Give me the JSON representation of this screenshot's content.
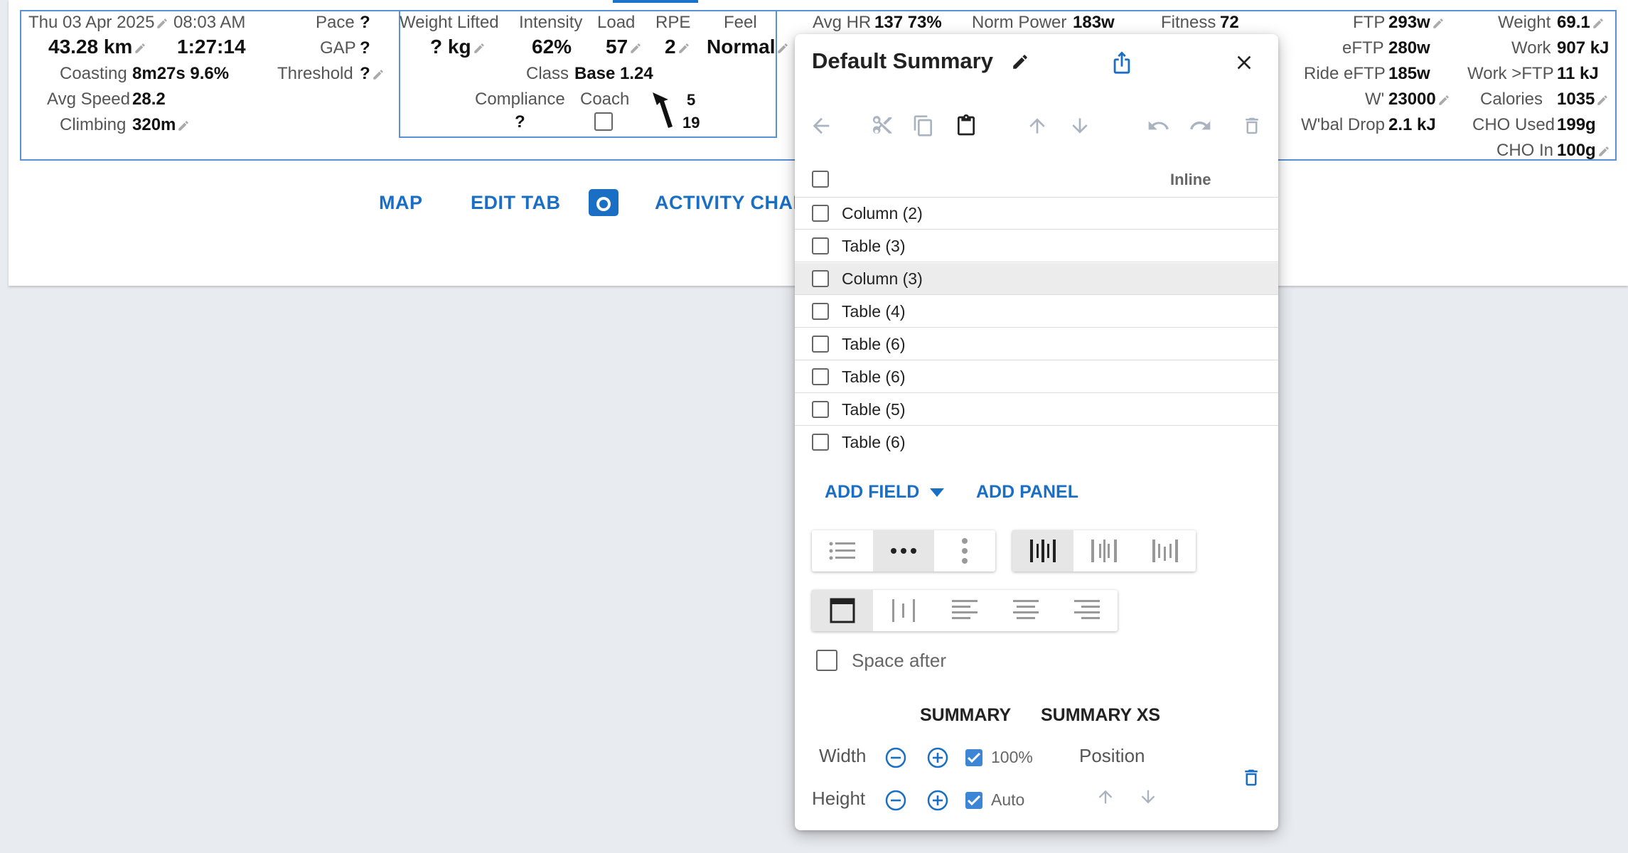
{
  "summary": {
    "date": "Thu 03 Apr 2025",
    "time": "08:03 AM",
    "distance": "43.28 km",
    "duration": "1:27:14",
    "coasting_label": "Coasting",
    "coasting_value": "8m27s 9.6%",
    "avg_speed_label": "Avg Speed",
    "avg_speed_value": "28.2",
    "climbing_label": "Climbing",
    "climbing_value": "320m",
    "pace_label": "Pace",
    "pace_value": "?",
    "gap_label": "GAP",
    "gap_value": "?",
    "threshold_label": "Threshold",
    "threshold_value": "?",
    "weight_lifted_label": "Weight Lifted",
    "weight_lifted_value": "? kg",
    "intensity_label": "Intensity",
    "intensity_value": "62%",
    "load_label": "Load",
    "load_value": "57",
    "rpe_label": "RPE",
    "rpe_value": "2",
    "feel_label": "Feel",
    "feel_value": "Normal",
    "class_label": "Class",
    "class_value": "Base 1.24",
    "compliance_label": "Compliance",
    "compliance_value": "?",
    "coach_label": "Coach",
    "arrow_num_1": "5",
    "arrow_num_2": "19",
    "avg_hr_label": "Avg HR",
    "avg_hr_value": "137 73%",
    "norm_power_label": "Norm Power",
    "norm_power_value": "183w",
    "fitness_label": "Fitness",
    "fitness_value": "72",
    "ftp_label": "FTP",
    "ftp_value": "293w",
    "eftp_label": "eFTP",
    "eftp_value": "280w",
    "ride_eftp_label": "Ride eFTP",
    "ride_eftp_value": "185w",
    "wprime_label": "W'",
    "wprime_value": "23000",
    "wbal_label": "W'bal Drop",
    "wbal_value": "2.1 kJ",
    "weight_label": "Weight",
    "weight_value": "69.1",
    "work_label": "Work",
    "work_value": "907 kJ",
    "work_ftp_label": "Work >FTP",
    "work_ftp_value": "11 kJ",
    "calories_label": "Calories",
    "calories_value": "1035",
    "cho_used_label": "CHO Used",
    "cho_used_value": "199g",
    "cho_in_label": "CHO In",
    "cho_in_value": "100g"
  },
  "tabs": {
    "map": "MAP",
    "edit_tab": "EDIT TAB",
    "activity_chart": "ACTIVITY CHAR"
  },
  "dialog": {
    "title": "Default Summary",
    "header_inline": "Inline",
    "rows": [
      {
        "label": "Column (2)"
      },
      {
        "label": "Table (3)"
      },
      {
        "label": "Column (3)"
      },
      {
        "label": "Table (4)"
      },
      {
        "label": "Table (6)"
      },
      {
        "label": "Table (6)"
      },
      {
        "label": "Table (5)"
      },
      {
        "label": "Table (6)"
      }
    ],
    "add_field": "ADD FIELD",
    "add_panel": "ADD PANEL",
    "space_after": "Space after",
    "tab_summary": "SUMMARY",
    "tab_summary_xs": "SUMMARY XS",
    "width_label": "Width",
    "width_value": "100%",
    "height_label": "Height",
    "height_value": "Auto",
    "position_label": "Position"
  },
  "colors": {
    "accent": "#1a6fc4",
    "border_blue": "#5b8fd6",
    "background": "#e8ebf0"
  }
}
